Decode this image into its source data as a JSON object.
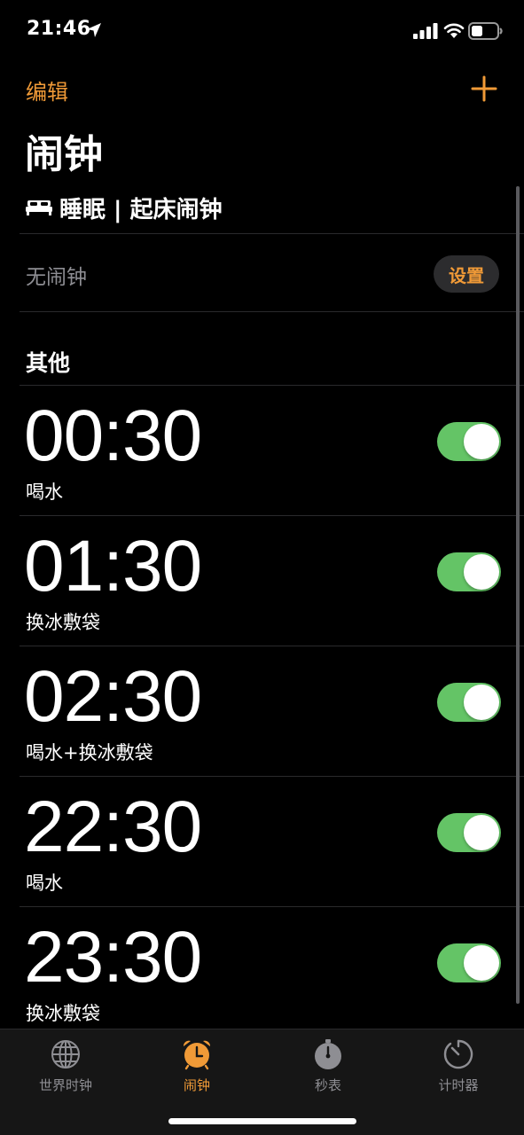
{
  "status_bar": {
    "time": "21:46"
  },
  "header": {
    "edit_label": "编辑",
    "title": "闹钟"
  },
  "sleep": {
    "title": "睡眠 | 起床闹钟",
    "no_alarm_text": "无闹钟",
    "setup_label": "设置"
  },
  "others": {
    "section_label": "其他",
    "alarms": [
      {
        "time": "00:30",
        "label": "喝水",
        "enabled": true
      },
      {
        "time": "01:30",
        "label": "换冰敷袋",
        "enabled": true
      },
      {
        "time": "02:30",
        "label": "喝水+换冰敷袋",
        "enabled": true
      },
      {
        "time": "22:30",
        "label": "喝水",
        "enabled": true
      },
      {
        "time": "23:30",
        "label": "换冰敷袋",
        "enabled": true
      }
    ]
  },
  "tab_bar": {
    "tabs": [
      {
        "label": "世界时钟",
        "icon": "globe-icon",
        "active": false
      },
      {
        "label": "闹钟",
        "icon": "alarm-clock-icon",
        "active": true
      },
      {
        "label": "秒表",
        "icon": "stopwatch-icon",
        "active": false
      },
      {
        "label": "计时器",
        "icon": "timer-icon",
        "active": false
      }
    ]
  },
  "colors": {
    "accent": "#f09a37",
    "toggle_on": "#64c466",
    "background": "#000000",
    "secondary_text": "#8e8e93"
  }
}
